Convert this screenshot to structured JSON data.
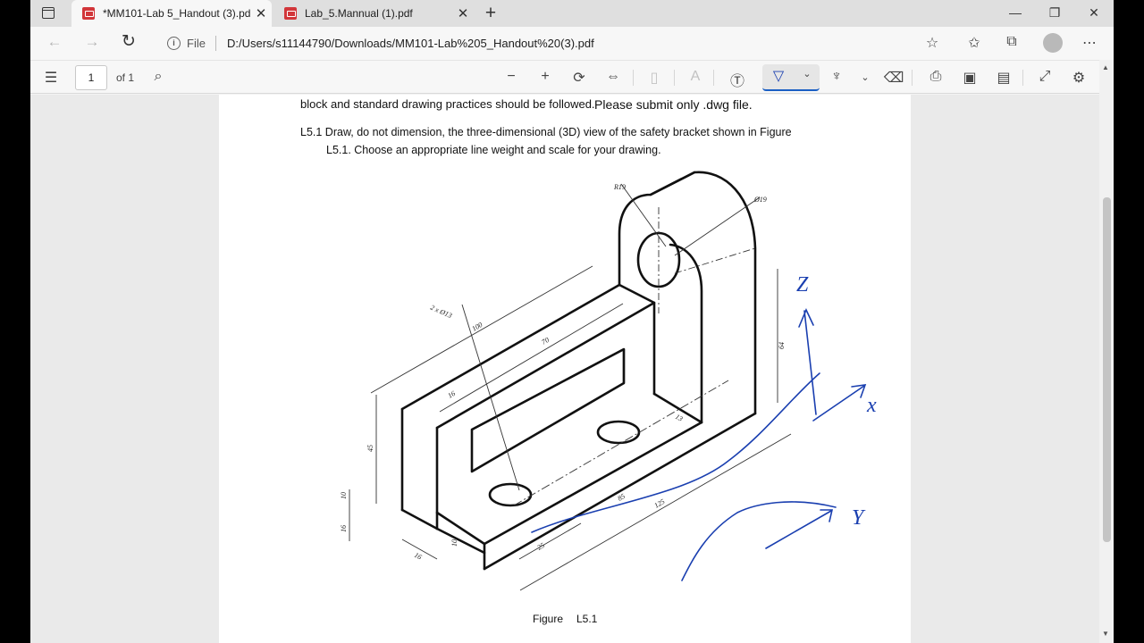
{
  "tabs": [
    {
      "title": "*MM101-Lab 5_Handout (3).pdf",
      "active": true
    },
    {
      "title": "Lab_5.Mannual (1).pdf",
      "active": false
    }
  ],
  "address": {
    "scheme_label": "File",
    "url": "D:/Users/s11144790/Downloads/MM101-Lab%205_Handout%20(3).pdf"
  },
  "pdf_toolbar": {
    "page_number": "1",
    "page_total": "of 1"
  },
  "document": {
    "line_top": "block and standard drawing practices should be followed.",
    "line_top_emph": "Please submit only .dwg file.",
    "task_line1": "L5.1 Draw, do not dimension, the three-dimensional (3D) view of the safety bracket shown in Figure",
    "task_line2": "L5.1. Choose an appropriate line weight and scale for your drawing.",
    "caption_label": "Figure",
    "caption_num": "L5.1",
    "dimensions": {
      "r19": "R19",
      "dia19": "Ø19",
      "holes": "2 x Ø13",
      "d100": "100",
      "d70": "70",
      "d16a": "16",
      "d45": "45",
      "d10a": "10",
      "d16b": "16",
      "d16c": "16",
      "d10b": "10",
      "d25": "25",
      "d125": "125",
      "d85": "85",
      "d13": "13",
      "d64": "64"
    },
    "annotations": {
      "z": "Z",
      "x": "x",
      "y": "Y"
    }
  },
  "colors": {
    "ink": "#1a3fb0",
    "active_underline": "#1a5fc4"
  }
}
